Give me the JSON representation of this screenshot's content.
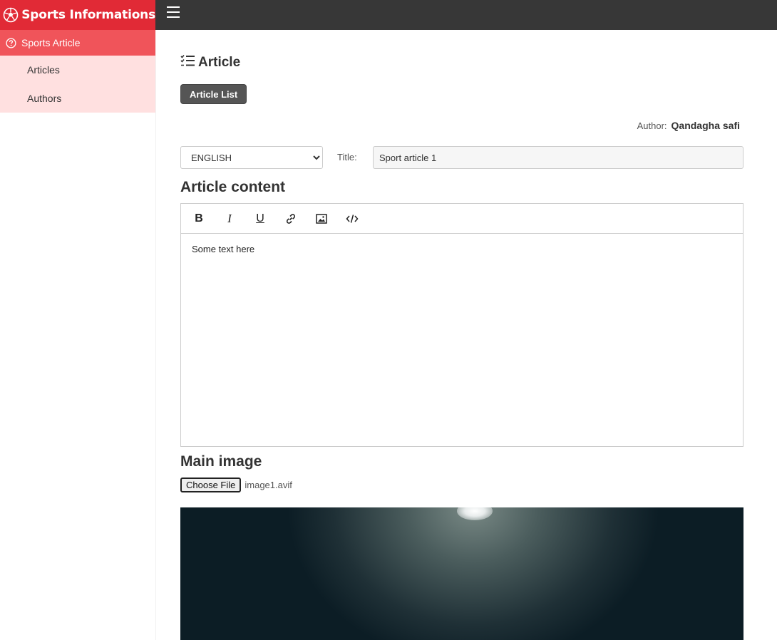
{
  "brand": {
    "title": "Sports Informations",
    "icon": "soccer-ball-icon"
  },
  "sidebar": {
    "section_label": "Sports Article",
    "section_icon": "question-circle-icon",
    "items": [
      {
        "label": "Articles"
      },
      {
        "label": "Authors"
      }
    ]
  },
  "page": {
    "heading": "Article",
    "heading_icon": "list-check-icon",
    "article_list_button": "Article List",
    "author_label": "Author:",
    "author_name": "Qandagha safi",
    "language_selected": "ENGLISH",
    "title_label": "Title:",
    "title_value": "Sport article 1",
    "content_heading": "Article content",
    "editor_text": "Some text here",
    "main_image_heading": "Main image",
    "choose_file_button": "Choose File",
    "file_name": "image1.avif"
  },
  "colors": {
    "brand": "#e12a36",
    "sidebar_active": "#f0545a",
    "sidebar_sub": "#ffe0e0",
    "topbar": "#373737"
  }
}
